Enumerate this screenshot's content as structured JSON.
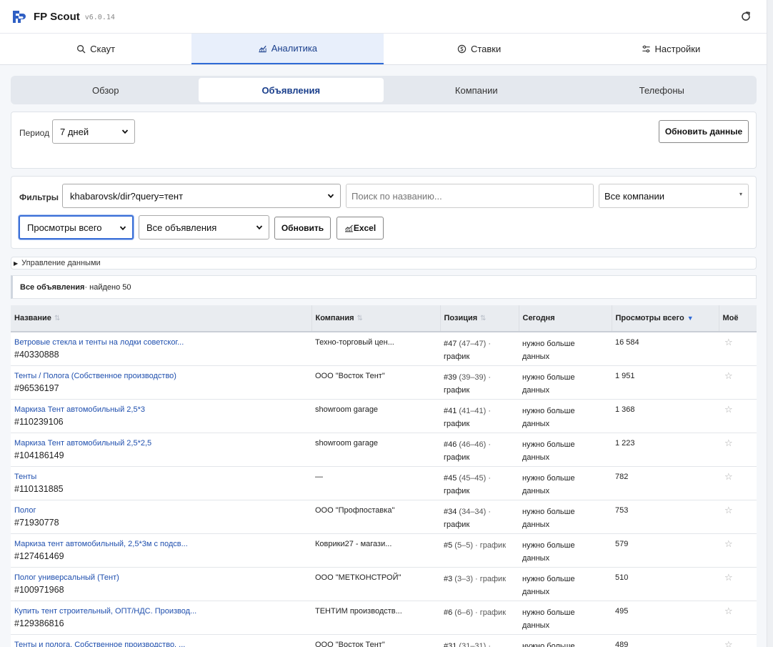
{
  "app": {
    "title": "FP Scout",
    "version": "v6.0.14"
  },
  "colors": {
    "accent": "#2f6ad6",
    "link": "#1f4fae",
    "active_tab_bg": "#e8effb"
  },
  "main_tabs": [
    {
      "label": "Скаут",
      "icon": "search-icon"
    },
    {
      "label": "Аналитика",
      "icon": "chart-icon"
    },
    {
      "label": "Ставки",
      "icon": "coin-icon"
    },
    {
      "label": "Настройки",
      "icon": "sliders-icon"
    }
  ],
  "sub_tabs": [
    "Обзор",
    "Объявления",
    "Компании",
    "Телефоны"
  ],
  "period": {
    "label": "Период",
    "value": "7 дней",
    "refresh_label": "Обновить данные"
  },
  "filters": {
    "label": "Фильтры",
    "query_value": "khabarovsk/dir?query=тент",
    "search_placeholder": "Поиск по названию...",
    "company_value": "Все компании",
    "metric_value": "Просмотры всего",
    "ads_value": "Все объявления",
    "update_label": "Обновить",
    "excel_label": "Excel"
  },
  "data_management": "Управление данными",
  "summary": {
    "title": "Все объявления",
    "found": " · найдено 50"
  },
  "table": {
    "headers": [
      "Название",
      "Компания",
      "Позиция",
      "Сегодня",
      "Просмотры всего",
      "Моё"
    ],
    "rows": [
      {
        "name": "Ветровые стекла и тенты на лодки советског...",
        "id": "#40330888",
        "company": "Техно-торговый цен...",
        "pos": "#47",
        "range": " (47–47) ·",
        "chart": "график",
        "today1": "нужно больше",
        "today2": "данных",
        "views": "16 584"
      },
      {
        "name": "Тенты / Полога (Собственное производство)",
        "id": "#96536197",
        "company": "ООО \"Восток Тент\"",
        "pos": "#39",
        "range": " (39–39) ·",
        "chart": "график",
        "today1": "нужно больше",
        "today2": "данных",
        "views": "1 951"
      },
      {
        "name": "Маркиза Тент автомобильный 2,5*3",
        "id": "#110239106",
        "company": "showroom garage",
        "pos": "#41",
        "range": " (41–41) ·",
        "chart": "график",
        "today1": "нужно больше",
        "today2": "данных",
        "views": "1 368"
      },
      {
        "name": "Маркиза Тент автомобильный 2,5*2,5",
        "id": "#104186149",
        "company": "showroom garage",
        "pos": "#46",
        "range": " (46–46) ·",
        "chart": "график",
        "today1": "нужно больше",
        "today2": "данных",
        "views": "1 223"
      },
      {
        "name": "Тенты",
        "id": "#110131885",
        "company": "—",
        "pos": "#45",
        "range": " (45–45) ·",
        "chart": "график",
        "today1": "нужно больше",
        "today2": "данных",
        "views": "782"
      },
      {
        "name": "Полог",
        "id": "#71930778",
        "company": "ООО \"Профпоставка\"",
        "pos": "#34",
        "range": " (34–34) ·",
        "chart": "график",
        "today1": "нужно больше",
        "today2": "данных",
        "views": "753"
      },
      {
        "name": "Маркиза тент автомобильный, 2,5*3м с подсв...",
        "id": "#127461469",
        "company": "Коврики27 - магази...",
        "pos": "#5",
        "range": " (5–5) · график",
        "chart": "",
        "today1": "нужно больше",
        "today2": "данных",
        "views": "579"
      },
      {
        "name": "Полог универсальный (Тент)",
        "id": "#100971968",
        "company": "ООО \"МЕТКОНСТРОЙ\"",
        "pos": "#3",
        "range": " (3–3) · график",
        "chart": "",
        "today1": "нужно больше",
        "today2": "данных",
        "views": "510"
      },
      {
        "name": "Купить тент строительный, ОПТ/НДС. Производ...",
        "id": "#129386816",
        "company": "ТЕНТИМ производств...",
        "pos": "#6",
        "range": " (6–6) · график",
        "chart": "",
        "today1": "нужно больше",
        "today2": "данных",
        "views": "495"
      },
      {
        "name": "Тенты и пологa. Собственное производство. ...",
        "id": "",
        "company": "ООО \"Восток Тент\"",
        "pos": "#31",
        "range": " (31–31) ·",
        "chart": "",
        "today1": "нужно больше",
        "today2": "",
        "views": "489"
      }
    ]
  }
}
